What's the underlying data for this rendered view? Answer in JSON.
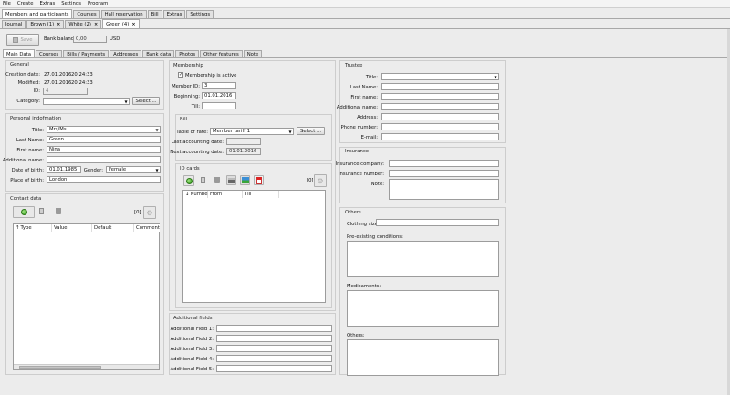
{
  "menu": [
    "File",
    "Create",
    "Extras",
    "Settings",
    "Program"
  ],
  "main_tabs": [
    "Members and participants",
    "Courses",
    "Hall reservation",
    "Bill",
    "Extras",
    "Settings"
  ],
  "sub_tabs": [
    {
      "label": "Journal"
    },
    {
      "label": "Brown (1)",
      "close": "×"
    },
    {
      "label": "White (2)",
      "close": "×"
    },
    {
      "label": "Green (4)",
      "close": "×"
    }
  ],
  "toolbar": {
    "save": "Save",
    "bank_balance_label": "Bank balance:",
    "bank_balance_value": "0,00",
    "currency": "USD"
  },
  "detail_tabs": [
    "Main Data",
    "Courses",
    "Bills / Payments",
    "Addresses",
    "Bank data",
    "Photos",
    "Other features",
    "Note"
  ],
  "general": {
    "title": "General",
    "creation_label": "Creation date:",
    "creation_date": "27.01.2016",
    "creation_time": "20:24:33",
    "modified_label": "Modified:",
    "modified_date": "27.01.2016",
    "modified_time": "20:24:33",
    "id_label": "ID:",
    "id_value": "4",
    "category_label": "Category:",
    "category_value": "",
    "select": "Select ..."
  },
  "personal": {
    "title": "Personal indofmation",
    "title_label": "Title:",
    "title_value": "Mrs/Ms",
    "last_label": "Last Name:",
    "last_value": "Green",
    "first_label": "First name:",
    "first_value": "Nina",
    "addname_label": "Additional name:",
    "addname_value": "",
    "dob_label": "Date of birth:",
    "dob_value": "01.01.1985",
    "gender_label": "Gender:",
    "gender_value": "Female",
    "pob_label": "Place of birth:",
    "pob_value": "London"
  },
  "contact": {
    "title": "Contact data",
    "count": "[0]",
    "cols": [
      "Type",
      "Value",
      "Default",
      "Comment"
    ]
  },
  "membership": {
    "title": "Membership",
    "active_label": "Membership is active",
    "check": "✓",
    "member_id_label": "Member ID:",
    "member_id": "3",
    "beginning_label": "Beginning:",
    "beginning": "01.01.2016",
    "till_label": "Till:",
    "till": ""
  },
  "bill": {
    "title": "Bill",
    "rate_label": "Table of rate:",
    "rate_value": "Member tariff 1",
    "select": "Select ...",
    "last_label": "Last accounting date:",
    "last_value": "",
    "next_label": "Next accounting date:",
    "next_value": "01.01.2016"
  },
  "idcards": {
    "title": "ID cards",
    "count": "[0]",
    "cols": [
      "Number",
      "From",
      "Till"
    ]
  },
  "additional": {
    "title": "Additional fields",
    "f1": "Additional Field 1:",
    "f2": "Additional Field 2:",
    "f3": "Additional Field 3:",
    "f4": "Additional Field 4:",
    "f5": "Additional Field 5:"
  },
  "trustee": {
    "title": "Trustee",
    "title_label": "Title:",
    "last_label": "Last Name:",
    "first_label": "First name:",
    "addname_label": "Additional name:",
    "address_label": "Address:",
    "phone_label": "Phone number:",
    "email_label": "E-mail:"
  },
  "insurance": {
    "title": "Insurance",
    "company_label": "Insurance company:",
    "number_label": "Insurance number:",
    "note_label": "Note:"
  },
  "others": {
    "title": "Others",
    "clothing_label": "Clothing size:",
    "preexisting_label": "Pre-existing conditions:",
    "medicaments_label": "Medicaments:",
    "others_label": "Others:"
  }
}
